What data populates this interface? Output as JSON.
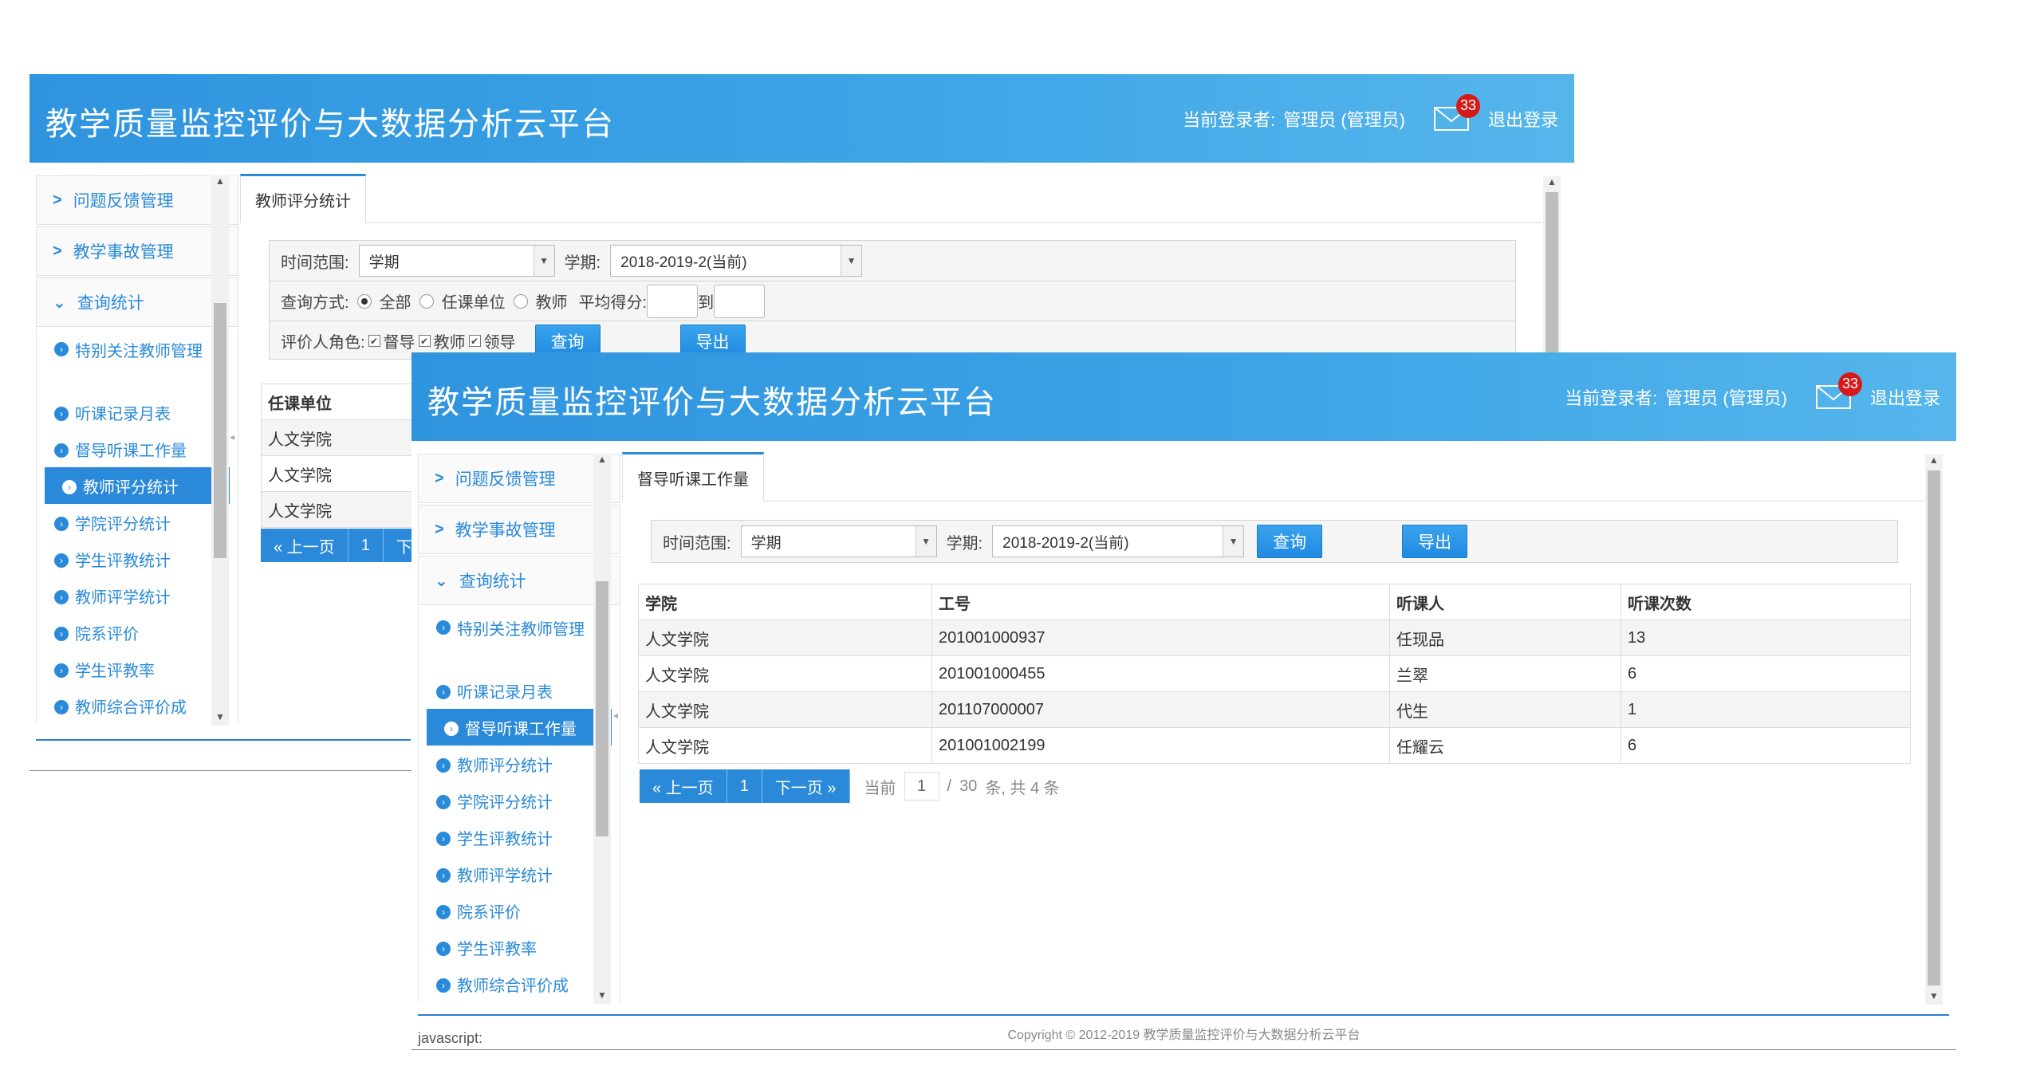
{
  "app_title": "教学质量监控评价与大数据分析云平台",
  "header": {
    "login_label": "当前登录者:",
    "user": "管理员 (管理员)",
    "mail_count": "33",
    "logout": "退出登录"
  },
  "menu": {
    "feedback": "问题反馈管理",
    "accident": "教学事故管理",
    "stats": "查询统计",
    "items": [
      "特别关注教师管理",
      "听课记录月表",
      "督导听课工作量",
      "教师评分统计",
      "学院评分统计",
      "学生评教统计",
      "教师评学统计",
      "院系评价",
      "学生评教率",
      "教师综合评价成"
    ]
  },
  "back": {
    "tab": "教师评分统计",
    "time_label": "时间范围:",
    "time_value": "学期",
    "term_label": "学期:",
    "term_value": "2018-2019-2(当前)",
    "mode_label": "查询方式:",
    "mode_options": [
      "全部",
      "任课单位",
      "教师"
    ],
    "avg_label": "平均得分:",
    "to_label": "到",
    "role_label": "评价人角色:",
    "roles": [
      "督导",
      "教师",
      "领导"
    ],
    "query": "查询",
    "export": "导出",
    "table_header": "任课单位",
    "rows": [
      "人文学院",
      "人文学院",
      "人文学院"
    ],
    "prev": "« 上一页",
    "page": "1",
    "next_partial": "下"
  },
  "front": {
    "tab": "督导听课工作量",
    "time_label": "时间范围:",
    "time_value": "学期",
    "term_label": "学期:",
    "term_value": "2018-2019-2(当前)",
    "query": "查询",
    "export": "导出",
    "columns": [
      "学院",
      "工号",
      "听课人",
      "听课次数"
    ],
    "rows": [
      [
        "人文学院",
        "201001000937",
        "任现品",
        "13"
      ],
      [
        "人文学院",
        "201001000455",
        "兰翠",
        "6"
      ],
      [
        "人文学院",
        "201107000007",
        "代生",
        "1"
      ],
      [
        "人文学院",
        "201001002199",
        "任耀云",
        "6"
      ]
    ],
    "pager": {
      "prev": "« 上一页",
      "page": "1",
      "next": "下一页 »",
      "current_label": "当前",
      "current": "1",
      "sep": "/",
      "total_pages": "30",
      "summary": "条, 共 4 条"
    },
    "copyright": "Copyright © 2012-2019 教学质量监控评价与大数据分析云平台",
    "status": "javascript:"
  }
}
